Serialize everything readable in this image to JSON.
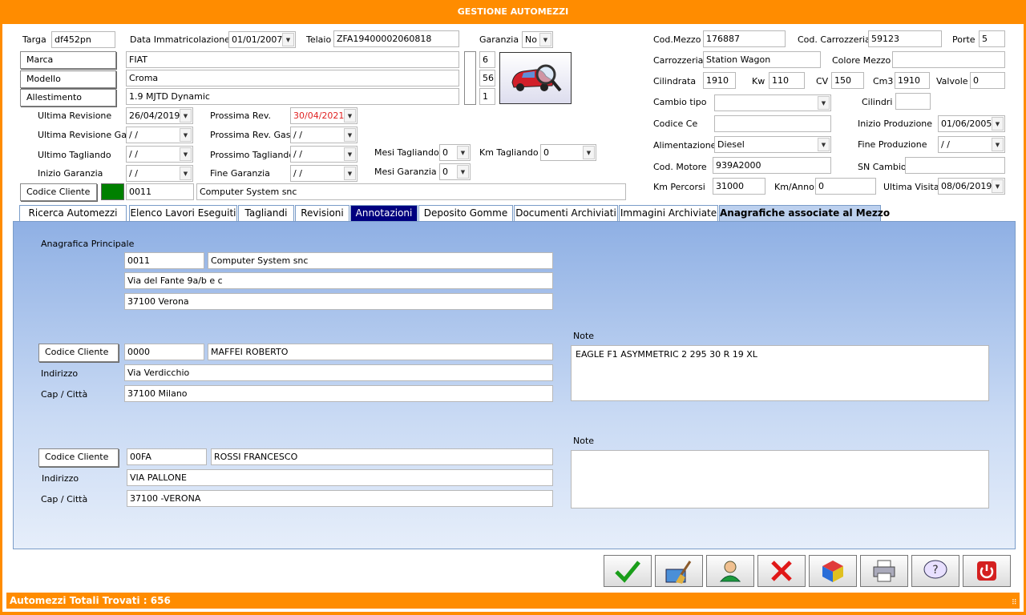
{
  "window": {
    "title": "GESTIONE AUTOMEZZI"
  },
  "vehicle": {
    "targa_label": "Targa",
    "targa": "df452pn",
    "data_imm_label": "Data Immatricolazione",
    "data_imm": "01/01/2007",
    "telaio_label": "Telaio",
    "telaio": "ZFA19400002060818",
    "garanzia_label": "Garanzia",
    "garanzia": "No",
    "marca_btn": "Marca",
    "marca": "FIAT",
    "marca_code": "6",
    "modello_btn": "Modello",
    "modello": "Croma",
    "modello_code": "56",
    "allestimento_btn": "Allestimento",
    "allestimento": "1.9 MJTD Dynamic",
    "allestimento_code": "1",
    "ultima_rev_label": "Ultima Revisione",
    "ultima_rev": "26/04/2019",
    "prossima_rev_label": "Prossima Rev.",
    "prossima_rev": "30/04/2021",
    "ultima_rev_gas_label": "Ultima Revisione Gas",
    "ultima_rev_gas": " /  /",
    "prossima_rev_gas_label": "Prossima Rev. Gas",
    "prossima_rev_gas": " /  /",
    "ultimo_tagliando_label": "Ultimo Tagliando",
    "ultimo_tagliando": " /  /",
    "prossimo_tagliando_label": "Prossimo Tagliando",
    "prossimo_tagliando": " /  /",
    "mesi_tagliando_label": "Mesi Tagliando",
    "mesi_tagliando": "0",
    "km_tagliando_label": "Km Tagliando",
    "km_tagliando": "0",
    "inizio_garanzia_label": "Inizio Garanzia",
    "inizio_garanzia": " /  /",
    "fine_garanzia_label": "Fine Garanzia",
    "fine_garanzia": " /  /",
    "mesi_garanzia_label": "Mesi Garanzia",
    "mesi_garanzia": "0",
    "codice_cliente_btn": "Codice Cliente",
    "codice_cliente": "0011",
    "cliente_nome": "Computer System snc",
    "status_color": "#008000"
  },
  "right": {
    "cod_mezzo_label": "Cod.Mezzo",
    "cod_mezzo": "176887",
    "cod_carrozzeria_label": "Cod. Carrozzeria",
    "cod_carrozzeria": "59123",
    "porte_label": "Porte",
    "porte": "5",
    "carrozzeria_label": "Carrozzeria",
    "carrozzeria": "Station Wagon",
    "colore_label": "Colore Mezzo",
    "colore": "",
    "cilindrata_label": "Cilindrata",
    "cilindrata": "1910",
    "kw_label": "Kw",
    "kw": "110",
    "cv_label": "CV",
    "cv": "150",
    "cm3_label": "Cm3",
    "cm3": "1910",
    "valvole_label": "Valvole",
    "valvole": "0",
    "cambio_label": "Cambio tipo",
    "cambio": "",
    "cilindri_label": "Cilindri",
    "cilindri": "",
    "codice_ce_label": "Codice Ce",
    "codice_ce": "",
    "inizio_prod_label": "Inizio Produzione",
    "inizio_prod": "01/06/2005",
    "alimentazione_label": "Alimentazione",
    "alimentazione": "Diesel",
    "fine_prod_label": "Fine Produzione",
    "fine_prod": " /  /",
    "cod_motore_label": "Cod. Motore",
    "cod_motore": "939A2000",
    "sn_cambio_label": "SN Cambio",
    "sn_cambio": "",
    "km_percorsi_label": "Km Percorsi",
    "km_percorsi": "31000",
    "km_anno_label": "Km/Anno",
    "km_anno": "0",
    "ultima_visita_label": "Ultima Visita",
    "ultima_visita": "08/06/2019"
  },
  "tabs": [
    {
      "label": "Ricerca Automezzi"
    },
    {
      "label": "Elenco Lavori Eseguiti"
    },
    {
      "label": "Tagliandi"
    },
    {
      "label": "Revisioni"
    },
    {
      "label": "Annotazioni"
    },
    {
      "label": "Deposito Gomme"
    },
    {
      "label": "Documenti Archiviati"
    },
    {
      "label": "Immagini Archiviate"
    },
    {
      "label": "Anagrafiche associate al Mezzo"
    }
  ],
  "panel": {
    "principale_title": "Anagrafica Principale",
    "principale": {
      "codice": "0011",
      "nome": "Computer System snc",
      "indirizzo": "Via del Fante 9a/b e c",
      "citta": "37100 Verona"
    },
    "a1": {
      "btn": "Codice Cliente",
      "codice": "0000",
      "nome": "MAFFEI ROBERTO",
      "indirizzo_label": "Indirizzo",
      "indirizzo": "Via Verdicchio",
      "citta_label": "Cap / Città",
      "citta": "37100 Milano",
      "note_label": "Note",
      "note": "EAGLE F1 ASYMMETRIC 2 295 30 R 19 XL"
    },
    "a2": {
      "btn": "Codice Cliente",
      "codice": "00FA",
      "nome": "ROSSI FRANCESCO",
      "indirizzo_label": "Indirizzo",
      "indirizzo": "VIA PALLONE",
      "citta_label": "Cap / Città",
      "citta": "37100 -VERONA",
      "note_label": "Note",
      "note": ""
    }
  },
  "status": {
    "text": "Automezzi Totali Trovati : 656"
  }
}
